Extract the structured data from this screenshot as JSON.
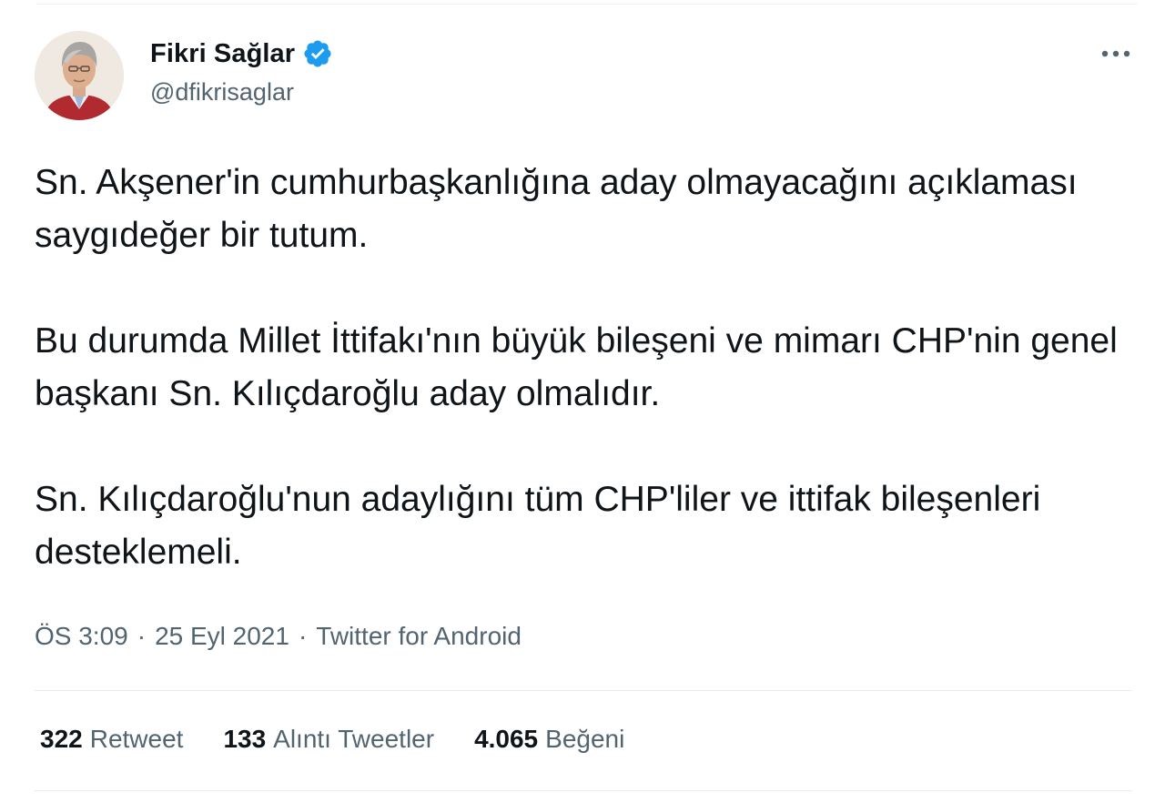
{
  "author": {
    "display_name": "Fikri Sağlar",
    "handle": "@dfikrisaglar",
    "verified": true,
    "avatar_icon": "profile-photo"
  },
  "tweet": {
    "paragraphs": [
      "Sn. Akşener'in cumhurbaşkanlığına aday olmayacağını açıklaması saygıdeğer bir tutum.",
      "Bu durumda Millet İttifakı'nın büyük bileşeni ve mimarı CHP'nin genel başkanı Sn. Kılıçdaroğlu aday olmalıdır.",
      "Sn. Kılıçdaroğlu'nun adaylığını tüm CHP'liler ve ittifak bileşenleri desteklemeli."
    ],
    "time": "ÖS 3:09",
    "separator": "·",
    "date": "25 Eyl 2021",
    "source": "Twitter for Android"
  },
  "stats": {
    "retweets": {
      "count": "322",
      "label": "Retweet"
    },
    "quotes": {
      "count": "133",
      "label": "Alıntı Tweetler"
    },
    "likes": {
      "count": "4.065",
      "label": "Beğeni"
    }
  },
  "colors": {
    "verified_badge": "#1d9bf0",
    "secondary_text": "#536471",
    "primary_text": "#0f1419"
  }
}
